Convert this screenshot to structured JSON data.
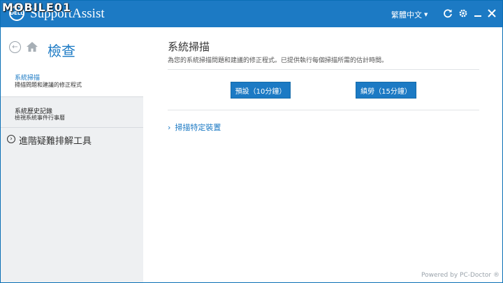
{
  "window": {
    "app_title": "SupportAssist",
    "logo_text": "DELL",
    "watermark": "MOBILE01",
    "language": "繁體中文",
    "icons": [
      "refresh-icon",
      "gear-icon",
      "minimize-icon",
      "close-icon"
    ]
  },
  "sidebar": {
    "title": "檢查",
    "items": [
      {
        "label": "系統掃描",
        "sublabel": "掃描問題和建議的修正程式",
        "selected": true
      },
      {
        "label": "系統歷史記錄",
        "sublabel": "檢視系統事件行事曆",
        "selected": false
      }
    ],
    "advanced": "進階疑難排解工具"
  },
  "main": {
    "title": "系統掃描",
    "description": "為您的系統掃描問題和建議的修正程式。已提供執行每個掃描所需的估計時間。",
    "buttons": {
      "default": "預設（10分鐘）",
      "thorough": "縝勞（15分鐘）"
    },
    "specific_device": "掃描特定裝置"
  },
  "footer": "Powered by PC-Doctor ®",
  "colors": {
    "accent": "#1c7ac4",
    "sidebar_bg": "#eef0f2"
  }
}
